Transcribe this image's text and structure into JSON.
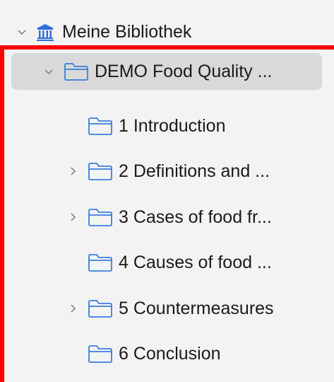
{
  "tree": {
    "root": {
      "label": "Meine Bibliothek",
      "icon": "library-icon",
      "expanded": true
    },
    "collection": {
      "label": "DEMO Food Quality ...",
      "icon": "folder-icon",
      "expanded": true,
      "selected": true
    },
    "children": [
      {
        "label": "1 Introduction",
        "has_children": false
      },
      {
        "label": "2 Definitions and ...",
        "has_children": true
      },
      {
        "label": "3 Cases of food fr...",
        "has_children": true
      },
      {
        "label": "4 Causes of food ...",
        "has_children": false
      },
      {
        "label": "5 Countermeasures",
        "has_children": true
      },
      {
        "label": "6 Conclusion",
        "has_children": false
      }
    ]
  },
  "colors": {
    "folder_stroke": "#3b7de0",
    "library_icon": "#2f6fd8",
    "selection": "#d9d9d9",
    "highlight": "#ff0000",
    "chevron": "#7a7a7a"
  }
}
